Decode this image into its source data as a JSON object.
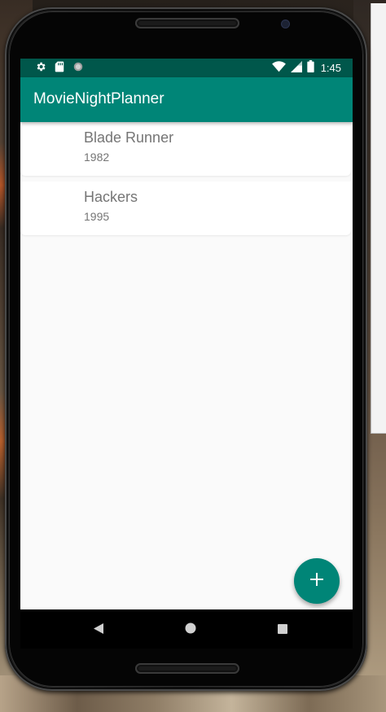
{
  "status_bar": {
    "time": "1:45",
    "left_icons": [
      "gear-icon",
      "sd-card-icon",
      "sync-circle-icon"
    ],
    "right_icons": [
      "wifi-icon",
      "cell-signal-icon",
      "battery-icon"
    ]
  },
  "app_bar": {
    "title": "MovieNightPlanner"
  },
  "movies": [
    {
      "title": "Blade Runner",
      "year": "1982"
    },
    {
      "title": "Hackers",
      "year": "1995"
    }
  ],
  "fab": {
    "icon": "plus-icon"
  },
  "nav_bar": {
    "buttons": [
      "back-icon",
      "home-icon",
      "recents-icon"
    ]
  },
  "colors": {
    "primary": "#008577",
    "primary_dark": "#00574b",
    "background": "#fafafa",
    "text_secondary": "#757575"
  }
}
